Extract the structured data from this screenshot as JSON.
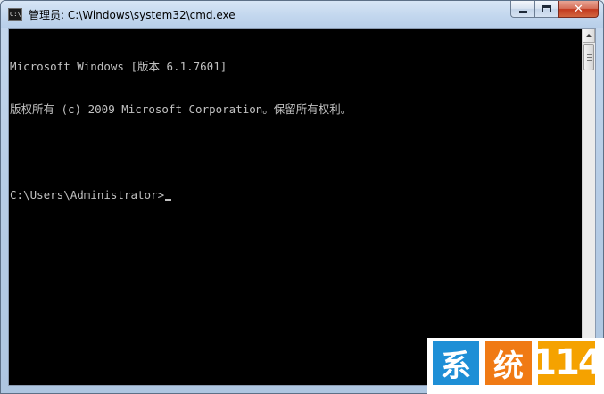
{
  "window": {
    "title": "管理员: C:\\Windows\\system32\\cmd.exe",
    "icon": "cmd-icon",
    "icon_glyph": "C:\\",
    "buttons": {
      "minimize_icon": "minimize-icon",
      "maximize_icon": "maximize-icon",
      "close_icon": "close-icon",
      "close_glyph": "✕"
    }
  },
  "console": {
    "lines": [
      "Microsoft Windows [版本 6.1.7601]",
      "版权所有 (c) 2009 Microsoft Corporation。保留所有权利。",
      "",
      "C:\\Users\\Administrator>"
    ],
    "text_color": "#c0c0c0",
    "background": "#000000"
  },
  "watermark": {
    "chars": [
      "系",
      "统",
      "114"
    ],
    "colors": [
      "#1e8fd6",
      "#f07a14",
      "#f5a200"
    ]
  }
}
